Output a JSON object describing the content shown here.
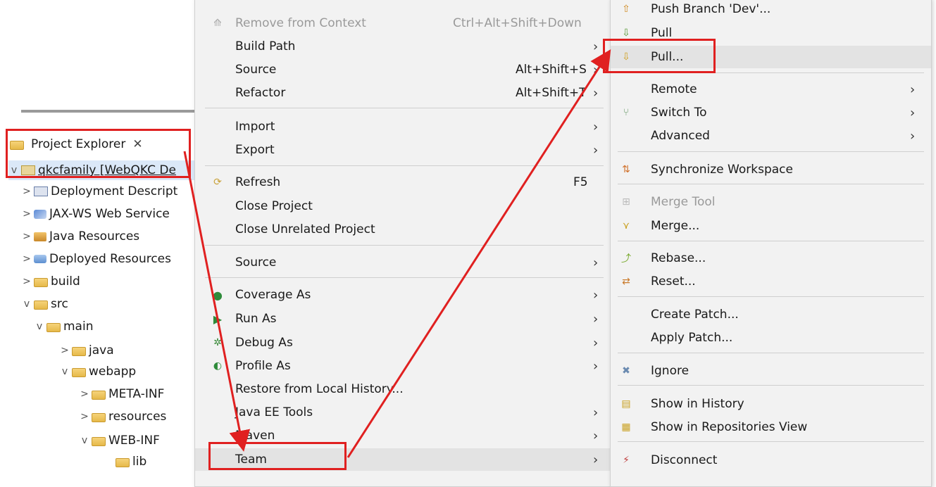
{
  "project_explorer": {
    "tab_label": "Project Explorer",
    "tree": [
      {
        "label": "qkcfamily [WebQKC De",
        "twisty": "v",
        "icon": "project-icon"
      },
      {
        "label": "Deployment Descript",
        "twisty": ">",
        "icon": "deployment-descriptor-icon"
      },
      {
        "label": "JAX-WS Web Service",
        "twisty": ">",
        "icon": "web-service-icon"
      },
      {
        "label": "Java Resources",
        "twisty": ">",
        "icon": "java-resources-icon"
      },
      {
        "label": "Deployed Resources",
        "twisty": ">",
        "icon": "deployed-resources-icon"
      },
      {
        "label": "build",
        "twisty": ">",
        "icon": "folder-icon"
      },
      {
        "label": "src",
        "twisty": "v",
        "icon": "source-folder-icon"
      },
      {
        "label": "main",
        "twisty": "v",
        "icon": "source-folder-icon"
      },
      {
        "label": "java",
        "twisty": ">",
        "icon": "source-folder-icon"
      },
      {
        "label": "webapp",
        "twisty": "v",
        "icon": "source-folder-icon"
      },
      {
        "label": "META-INF",
        "twisty": ">",
        "icon": "source-folder-icon"
      },
      {
        "label": "resources",
        "twisty": ">",
        "icon": "source-folder-icon"
      },
      {
        "label": "WEB-INF",
        "twisty": "v",
        "icon": "source-folder-icon"
      },
      {
        "label": "lib",
        "twisty": "",
        "icon": "folder-icon"
      }
    ]
  },
  "context_menu": {
    "items": [
      {
        "label": "Remove from Context",
        "shortcut": "Ctrl+Alt+Shift+Down",
        "submenu": false,
        "disabled": true
      },
      {
        "label": "Build Path",
        "shortcut": "",
        "submenu": true
      },
      {
        "label": "Source",
        "shortcut": "Alt+Shift+S",
        "submenu": true
      },
      {
        "label": "Refactor",
        "shortcut": "Alt+Shift+T",
        "submenu": true
      },
      {
        "label": "Import",
        "shortcut": "",
        "submenu": true
      },
      {
        "label": "Export",
        "shortcut": "",
        "submenu": true
      },
      {
        "label": "Refresh",
        "shortcut": "F5",
        "submenu": false
      },
      {
        "label": "Close Project",
        "shortcut": "",
        "submenu": false
      },
      {
        "label": "Close Unrelated Project",
        "shortcut": "",
        "submenu": false
      },
      {
        "label": "Source",
        "shortcut": "",
        "submenu": true
      },
      {
        "label": "Coverage As",
        "shortcut": "",
        "submenu": true
      },
      {
        "label": "Run As",
        "shortcut": "",
        "submenu": true
      },
      {
        "label": "Debug As",
        "shortcut": "",
        "submenu": true
      },
      {
        "label": "Profile As",
        "shortcut": "",
        "submenu": true
      },
      {
        "label": "Restore from Local History...",
        "shortcut": "",
        "submenu": false
      },
      {
        "label": "Java EE Tools",
        "shortcut": "",
        "submenu": true
      },
      {
        "label": "Maven",
        "shortcut": "",
        "submenu": true
      },
      {
        "label": "Team",
        "shortcut": "",
        "submenu": true
      }
    ]
  },
  "team_submenu": {
    "items": [
      {
        "label": "Push Branch 'Dev'...",
        "submenu": false
      },
      {
        "label": "Pull",
        "submenu": false
      },
      {
        "label": "Pull...",
        "submenu": false
      },
      {
        "label": "Remote",
        "submenu": true
      },
      {
        "label": "Switch To",
        "submenu": true
      },
      {
        "label": "Advanced",
        "submenu": true
      },
      {
        "label": "Synchronize Workspace",
        "submenu": false
      },
      {
        "label": "Merge Tool",
        "submenu": false,
        "disabled": true
      },
      {
        "label": "Merge...",
        "submenu": false
      },
      {
        "label": "Rebase...",
        "submenu": false
      },
      {
        "label": "Reset...",
        "submenu": false
      },
      {
        "label": "Create Patch...",
        "submenu": false
      },
      {
        "label": "Apply Patch...",
        "submenu": false
      },
      {
        "label": "Ignore",
        "submenu": false
      },
      {
        "label": "Show in History",
        "submenu": false
      },
      {
        "label": "Show in Repositories View",
        "submenu": false
      },
      {
        "label": "Disconnect",
        "submenu": false
      }
    ]
  },
  "annotation": {
    "color": "#e02020"
  },
  "colors": {
    "menu_bg": "#f2f2f2",
    "highlight": "#e3e3e3",
    "selection": "#dbe8f8"
  }
}
